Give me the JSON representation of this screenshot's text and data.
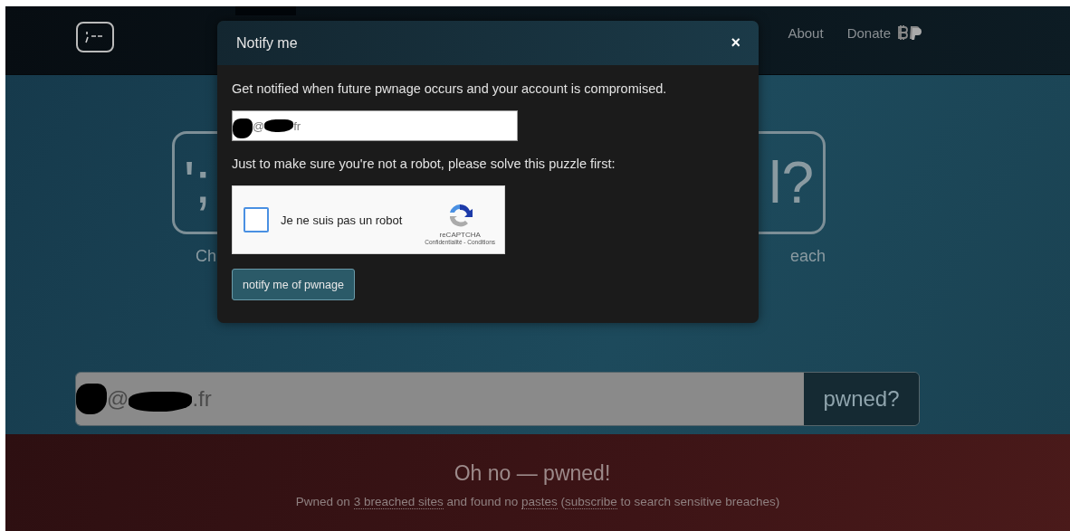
{
  "nav": {
    "links": [
      "About",
      "Donate"
    ]
  },
  "hero": {
    "left_logo": "';",
    "right_logo": "l?",
    "left_caption": "Ch",
    "right_caption": "each"
  },
  "search": {
    "segments": [
      {
        "kind": "redacted"
      },
      {
        "kind": "text",
        "text": "@"
      },
      {
        "kind": "redacted"
      },
      {
        "kind": "text",
        "text": ".fr"
      }
    ],
    "button": "pwned?"
  },
  "result": {
    "title": "Oh no — pwned!",
    "summary": [
      {
        "kind": "text",
        "text": "Pwned on "
      },
      {
        "kind": "link",
        "text": "3 breached sites"
      },
      {
        "kind": "text",
        "text": " and found no "
      },
      {
        "kind": "link",
        "text": "pastes"
      },
      {
        "kind": "text",
        "text": " ("
      },
      {
        "kind": "link",
        "text": "subscribe"
      },
      {
        "kind": "text",
        "text": " to search sensitive breaches)"
      }
    ]
  },
  "modal": {
    "title": "Notify me",
    "close": "×",
    "intro": "Get notified when future pwnage occurs and your account is compromised.",
    "email_segments": [
      {
        "kind": "redacted"
      },
      {
        "kind": "text",
        "text": "@"
      },
      {
        "kind": "redacted"
      },
      {
        "kind": "text",
        "text": "fr"
      }
    ],
    "robot_prompt": "Just to make sure you're not a robot, please solve this puzzle first:",
    "captcha": {
      "label": "Je ne suis pas un robot",
      "checked": false,
      "brand": "reCAPTCHA",
      "terms": "Confidentialité - Conditions"
    },
    "submit": "notify me of pwnage"
  }
}
